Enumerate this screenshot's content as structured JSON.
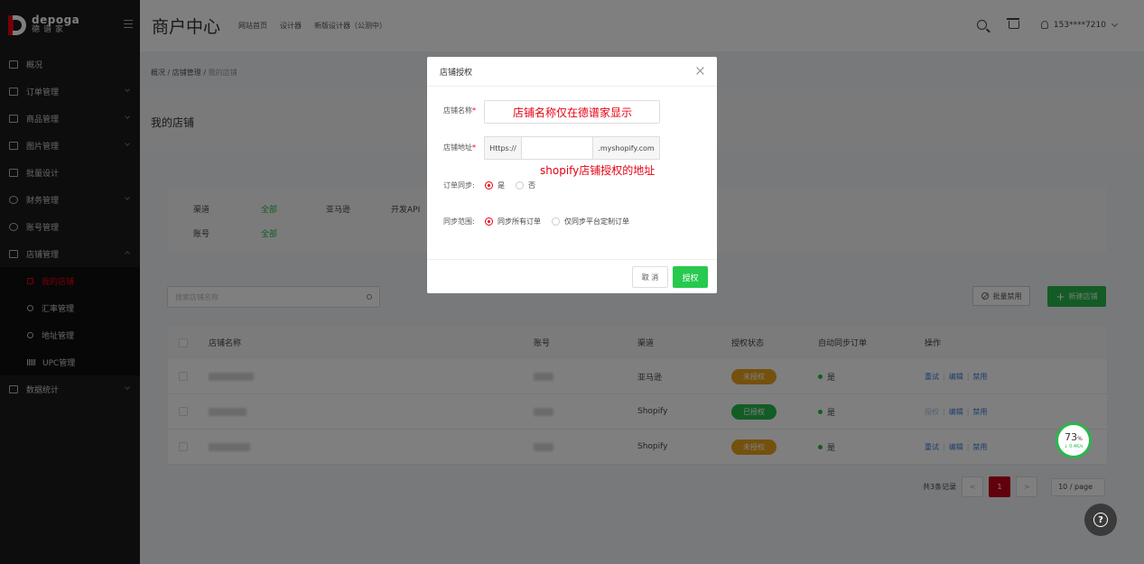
{
  "app": {
    "logo_en": "depoga",
    "logo_cn": "德谱家",
    "title": "商户中心",
    "nav": [
      "网站首页",
      "设计器",
      "新版设计器（公测中）"
    ],
    "user": "153****7210"
  },
  "sidebar": {
    "items": [
      {
        "label": "概况"
      },
      {
        "label": "订单管理"
      },
      {
        "label": "商品管理"
      },
      {
        "label": "图片管理"
      },
      {
        "label": "批量设计"
      },
      {
        "label": "财务管理"
      },
      {
        "label": "账号管理"
      },
      {
        "label": "店铺管理"
      },
      {
        "label": "数据统计"
      }
    ],
    "sub_items": [
      {
        "label": "我的店铺"
      },
      {
        "label": "汇率管理"
      },
      {
        "label": "地址管理"
      },
      {
        "label": "UPC管理"
      }
    ]
  },
  "breadcrumb": {
    "p1": "概况",
    "p2": "店铺管理",
    "current": "我的店铺",
    "sep": "/"
  },
  "page": {
    "title": "我的店铺"
  },
  "filter": {
    "channel_label": "渠道",
    "channel_options": [
      "全部",
      "亚马逊",
      "开发API"
    ],
    "account_label": "账号",
    "account_options": [
      "全部"
    ]
  },
  "toolbar": {
    "search_placeholder": "搜索店铺名称",
    "bulk_disable": "批量禁用",
    "new_store": "新建店铺"
  },
  "table": {
    "headers": {
      "name": "店铺名称",
      "account": "账号",
      "channel": "渠道",
      "status": "授权状态",
      "sync": "自动同步订单",
      "ops": "操作"
    },
    "rows": [
      {
        "channel": "亚马逊",
        "status": "未授权",
        "sync": "是",
        "ops": [
          "重试",
          "编辑",
          "禁用"
        ],
        "status_kind": "unauth"
      },
      {
        "channel": "Shopify",
        "status": "已授权",
        "sync": "是",
        "ops": [
          "授权",
          "编辑",
          "禁用"
        ],
        "status_kind": "auth"
      },
      {
        "channel": "Shopify",
        "status": "未授权",
        "sync": "是",
        "ops": [
          "重试",
          "编辑",
          "禁用"
        ],
        "status_kind": "unauth"
      }
    ]
  },
  "pagination": {
    "total": "共3条记录",
    "prev": "<",
    "current": "1",
    "next": ">",
    "page_size": "10 / page"
  },
  "widgets": {
    "speed_pct": "73",
    "speed_unit": "%",
    "speed_rate": "↓ 0.4K/s",
    "help": "?"
  },
  "modal": {
    "title": "店铺授权",
    "name_label": "店铺名称",
    "required_mark": "*",
    "name_annotation": "店铺名称仅在德谱家显示",
    "url_label": "店铺地址",
    "url_prefix": "Https://",
    "url_suffix": ".myshopify.com",
    "url_annotation": "shopify店铺授权的地址",
    "sync_label": "订单同步:",
    "sync_yes": "是",
    "sync_no": "否",
    "range_label": "同步范围:",
    "range_all": "同步所有订单",
    "range_custom": "仅同步平台定制订单",
    "cancel": "取 消",
    "submit": "授权"
  },
  "colors": {
    "brand_red": "#e60012",
    "green": "#27b84a",
    "orange": "#e9a21a",
    "sidebar_bg": "#1a1a1a"
  }
}
